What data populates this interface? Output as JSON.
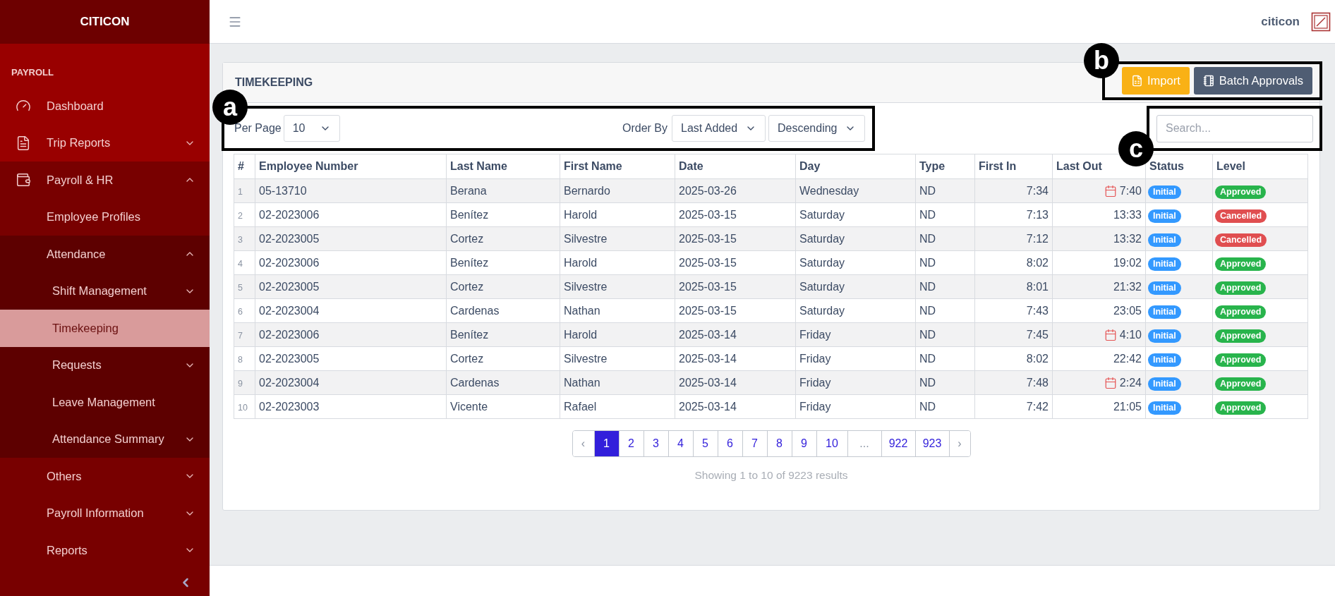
{
  "sidebar": {
    "brand": "CITICON",
    "section": "PAYROLL",
    "items": [
      {
        "label": "Dashboard",
        "selected": false
      },
      {
        "label": "Trip Reports",
        "selected": false,
        "expanded": false
      },
      {
        "label": "Payroll & HR",
        "selected": false,
        "expanded": true,
        "children": [
          {
            "label": "Employee Profiles",
            "selected": false
          },
          {
            "label": "Attendance",
            "selected": false,
            "expanded": true,
            "children": [
              {
                "label": "Shift Management",
                "selected": false,
                "expanded": false
              },
              {
                "label": "Timekeeping",
                "selected": true
              },
              {
                "label": "Requests",
                "selected": false,
                "expanded": false
              },
              {
                "label": "Leave Management",
                "selected": false
              },
              {
                "label": "Attendance Summary",
                "selected": false,
                "expanded": false
              }
            ]
          }
        ]
      },
      {
        "label": "Others",
        "selected": false,
        "expanded": false
      },
      {
        "label": "Payroll Information",
        "selected": false,
        "expanded": false
      },
      {
        "label": "Reports",
        "selected": false,
        "expanded": false
      }
    ]
  },
  "header": {
    "user": "citicon"
  },
  "card": {
    "title": "TIMEKEEPING",
    "actions": {
      "callout": "b",
      "buttons": [
        {
          "label": "Import",
          "kind": "warning"
        },
        {
          "label": "Batch Approvals",
          "kind": "secondary"
        }
      ]
    },
    "controls": {
      "callout": "a",
      "per_page_label": "Per Page",
      "per_page": "10",
      "order_by_label": "Order By",
      "order_by": "Last Added",
      "direction": "Descending"
    },
    "search": {
      "callout": "c",
      "placeholder": "Search..."
    },
    "table": {
      "columns": [
        "#",
        "Employee Number",
        "Last Name",
        "First Name",
        "Date",
        "Day",
        "Type",
        "First In",
        "Last Out",
        "Status",
        "Level"
      ],
      "rows": [
        {
          "n": "1",
          "employee": "05-13710",
          "last": "Berana",
          "first": "Bernardo",
          "date": "2025-03-26",
          "day": "Wednesday",
          "type": "ND",
          "in": "7:34",
          "out": "7:40",
          "calendar_flag": true,
          "status": {
            "label": "Initial",
            "color": "#3399ff"
          },
          "level": {
            "label": "Approved",
            "color": "#28b44c"
          }
        },
        {
          "n": "2",
          "employee": "02-2023006",
          "last": "Benítez",
          "first": "Harold",
          "date": "2025-03-15",
          "day": "Saturday",
          "type": "ND",
          "in": "7:13",
          "out": "13:33",
          "calendar_flag": false,
          "status": {
            "label": "Initial",
            "color": "#3399ff"
          },
          "level": {
            "label": "Cancelled",
            "color": "#e04e50"
          }
        },
        {
          "n": "3",
          "employee": "02-2023005",
          "last": "Cortez",
          "first": "Silvestre",
          "date": "2025-03-15",
          "day": "Saturday",
          "type": "ND",
          "in": "7:12",
          "out": "13:32",
          "calendar_flag": false,
          "status": {
            "label": "Initial",
            "color": "#3399ff"
          },
          "level": {
            "label": "Cancelled",
            "color": "#e04e50"
          }
        },
        {
          "n": "4",
          "employee": "02-2023006",
          "last": "Benítez",
          "first": "Harold",
          "date": "2025-03-15",
          "day": "Saturday",
          "type": "ND",
          "in": "8:02",
          "out": "19:02",
          "calendar_flag": false,
          "status": {
            "label": "Initial",
            "color": "#3399ff"
          },
          "level": {
            "label": "Approved",
            "color": "#28b44c"
          }
        },
        {
          "n": "5",
          "employee": "02-2023005",
          "last": "Cortez",
          "first": "Silvestre",
          "date": "2025-03-15",
          "day": "Saturday",
          "type": "ND",
          "in": "8:01",
          "out": "21:32",
          "calendar_flag": false,
          "status": {
            "label": "Initial",
            "color": "#3399ff"
          },
          "level": {
            "label": "Approved",
            "color": "#28b44c"
          }
        },
        {
          "n": "6",
          "employee": "02-2023004",
          "last": "Cardenas",
          "first": "Nathan",
          "date": "2025-03-15",
          "day": "Saturday",
          "type": "ND",
          "in": "7:43",
          "out": "23:05",
          "calendar_flag": false,
          "status": {
            "label": "Initial",
            "color": "#3399ff"
          },
          "level": {
            "label": "Approved",
            "color": "#28b44c"
          }
        },
        {
          "n": "7",
          "employee": "02-2023006",
          "last": "Benítez",
          "first": "Harold",
          "date": "2025-03-14",
          "day": "Friday",
          "type": "ND",
          "in": "7:45",
          "out": "4:10",
          "calendar_flag": true,
          "status": {
            "label": "Initial",
            "color": "#3399ff"
          },
          "level": {
            "label": "Approved",
            "color": "#28b44c"
          }
        },
        {
          "n": "8",
          "employee": "02-2023005",
          "last": "Cortez",
          "first": "Silvestre",
          "date": "2025-03-14",
          "day": "Friday",
          "type": "ND",
          "in": "8:02",
          "out": "22:42",
          "calendar_flag": false,
          "status": {
            "label": "Initial",
            "color": "#3399ff"
          },
          "level": {
            "label": "Approved",
            "color": "#28b44c"
          }
        },
        {
          "n": "9",
          "employee": "02-2023004",
          "last": "Cardenas",
          "first": "Nathan",
          "date": "2025-03-14",
          "day": "Friday",
          "type": "ND",
          "in": "7:48",
          "out": "2:24",
          "calendar_flag": true,
          "status": {
            "label": "Initial",
            "color": "#3399ff"
          },
          "level": {
            "label": "Approved",
            "color": "#28b44c"
          }
        },
        {
          "n": "10",
          "employee": "02-2023003",
          "last": "Vicente",
          "first": "Rafael",
          "date": "2025-03-14",
          "day": "Friday",
          "type": "ND",
          "in": "7:42",
          "out": "21:05",
          "calendar_flag": false,
          "status": {
            "label": "Initial",
            "color": "#3399ff"
          },
          "level": {
            "label": "Approved",
            "color": "#28b44c"
          }
        }
      ]
    },
    "pagination": {
      "pages": [
        {
          "label": "‹",
          "kind": "nav",
          "selected": false
        },
        {
          "label": "1",
          "kind": "page",
          "selected": true
        },
        {
          "label": "2",
          "kind": "page",
          "selected": false
        },
        {
          "label": "3",
          "kind": "page",
          "selected": false
        },
        {
          "label": "4",
          "kind": "page",
          "selected": false
        },
        {
          "label": "5",
          "kind": "page",
          "selected": false
        },
        {
          "label": "6",
          "kind": "page",
          "selected": false
        },
        {
          "label": "7",
          "kind": "page",
          "selected": false
        },
        {
          "label": "8",
          "kind": "page",
          "selected": false
        },
        {
          "label": "9",
          "kind": "page",
          "selected": false
        },
        {
          "label": "10",
          "kind": "page",
          "selected": false
        },
        {
          "label": "...",
          "kind": "gap",
          "selected": false
        },
        {
          "label": "922",
          "kind": "page",
          "selected": false
        },
        {
          "label": "923",
          "kind": "page",
          "selected": false
        },
        {
          "label": "›",
          "kind": "nav",
          "selected": false
        }
      ],
      "summary": "Showing 1 to 10 of 9223 results"
    }
  }
}
